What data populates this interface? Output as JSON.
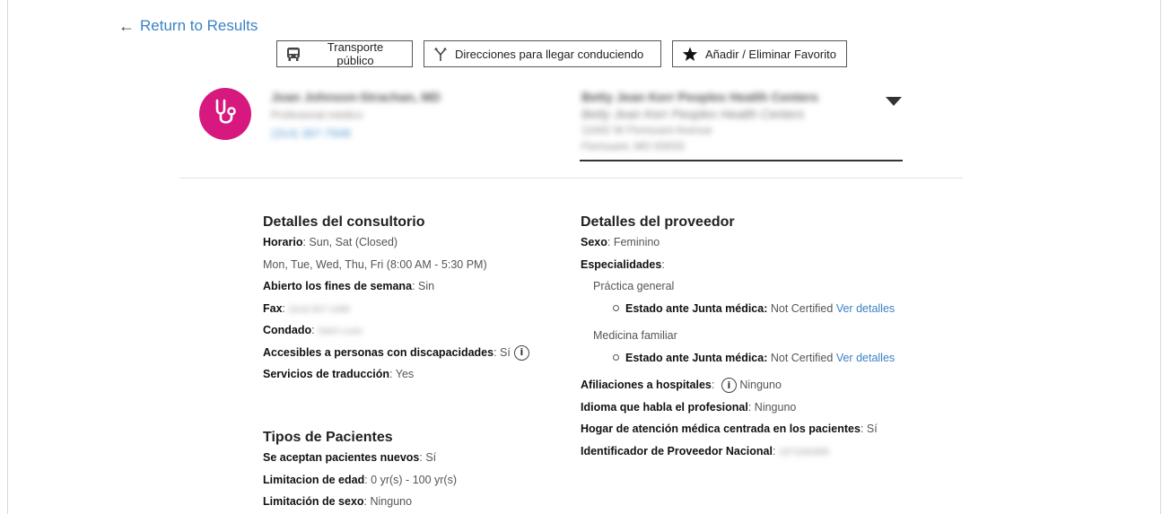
{
  "nav": {
    "return_label": "Return to Results"
  },
  "actions": {
    "transit": "Transporte público",
    "driving": "Direcciones para llegar conduciendo",
    "favorite": "Añadir / Eliminar Favorito"
  },
  "provider": {
    "name": "Joan Johnson-Strachan, MD",
    "type": "Profesional médico",
    "phone": "(314) 367-7848",
    "icon": "stethoscope-icon",
    "brand_color": "#d6187f"
  },
  "location": {
    "name": "Betty Jean Kerr Peoples Health Centers",
    "name2": "Betty Jean Kerr Peoples Health Centers",
    "address1": "11642 W Florissant Avenue",
    "address2": "Florissant, MO 63033"
  },
  "office": {
    "title": "Detalles del consultorio",
    "hours_label": "Horario",
    "hours_value": "Sun, Sat (Closed)",
    "hours_value2": "Mon, Tue, Wed, Thu, Fri (8:00 AM - 5:30 PM)",
    "weekend_label": "Abierto los fines de semana",
    "weekend_value": "Sin",
    "fax_label": "Fax",
    "fax_value": "(314) 927-1496",
    "county_label": "Condado",
    "county_value": "Saint Louis",
    "accessible_label": "Accesibles a personas con discapacidades",
    "accessible_value": "Sí",
    "translation_label": "Servicios de traducción",
    "translation_value": "Yes"
  },
  "patients": {
    "title": "Tipos de Pacientes",
    "new_label": "Se aceptan pacientes nuevos",
    "new_value": "Sí",
    "age_label": "Limitacion de edad",
    "age_value": "0 yr(s) - 100 yr(s)",
    "sex_label": "Limitación de sexo",
    "sex_value": "Ninguno"
  },
  "details": {
    "title": "Detalles del proveedor",
    "sex_label": "Sexo",
    "sex_value": "Feminino",
    "specialties_label": "Especialidades",
    "specialties": [
      {
        "name": "Práctica general",
        "board_label": "Estado ante Junta médica:",
        "board_value": "Not Certified",
        "link": "Ver detalles"
      },
      {
        "name": "Medicina familiar",
        "board_label": "Estado ante Junta médica:",
        "board_value": "Not Certified",
        "link": "Ver detalles"
      }
    ],
    "hospital_label": "Afiliaciones a hospitales",
    "hospital_value": "Ninguno",
    "language_label": "Idioma que habla el profesional",
    "language_value": "Ninguno",
    "home_label": "Hogar de atención médica centrada en los pacientes",
    "home_value": "Sí",
    "npi_label": "Identificador de Proveedor Nacional",
    "npi_value": "1871092899"
  }
}
